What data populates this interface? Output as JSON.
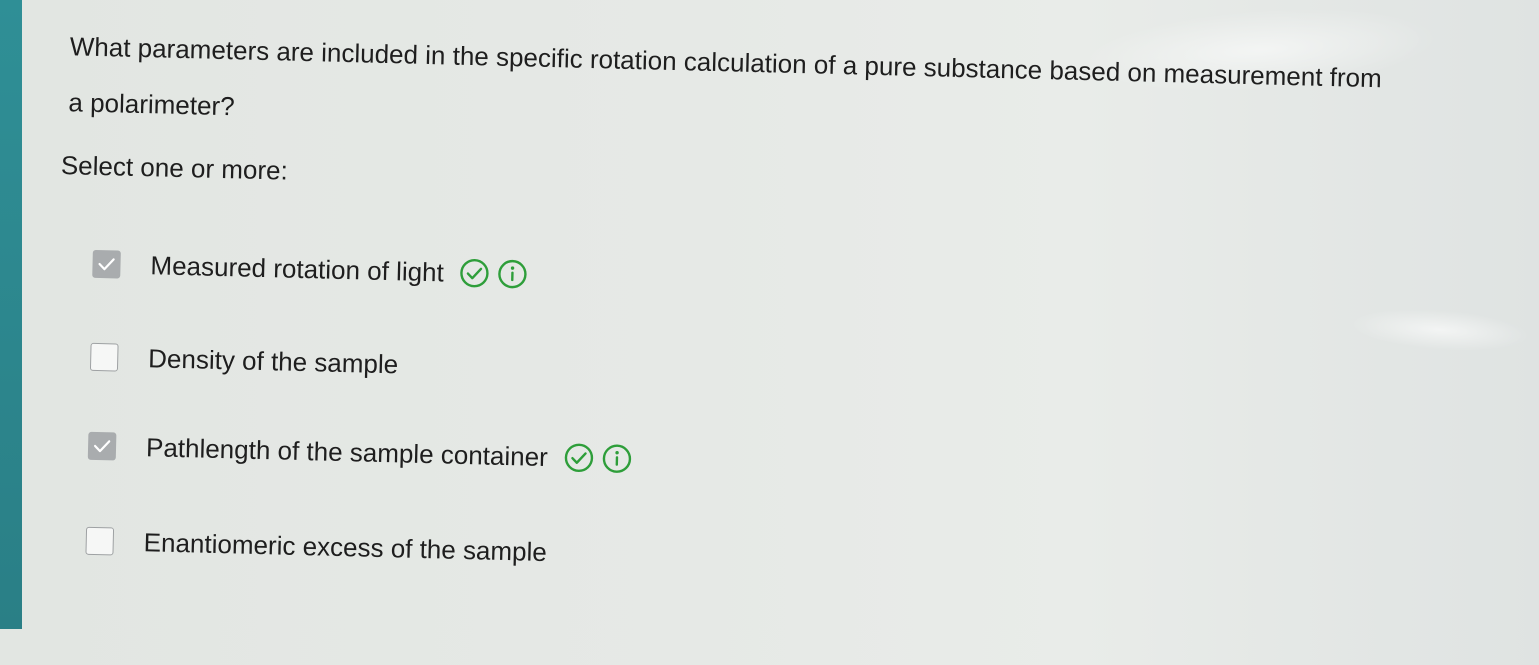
{
  "question": {
    "text": "What parameters are included in the specific rotation calculation of a pure substance based on measurement from a polarimeter?",
    "prompt": "Select one or more:"
  },
  "options": [
    {
      "label": "Measured rotation of light",
      "selected": true,
      "feedback": "correct"
    },
    {
      "label": "Density of the sample",
      "selected": false,
      "feedback": null
    },
    {
      "label": "Pathlength of the sample container",
      "selected": true,
      "feedback": "correct"
    },
    {
      "label": "Enantiomeric excess of the sample",
      "selected": false,
      "feedback": null
    }
  ],
  "colors": {
    "correct_green": "#2e9e3a",
    "checkbox_checked": "#a9acae",
    "checkbox_border": "#9ea1a3",
    "text": "#1e1e1e"
  },
  "icons": {
    "correct": "check-circle-icon",
    "info": "info-circle-icon",
    "checkmark": "checkmark-icon"
  }
}
